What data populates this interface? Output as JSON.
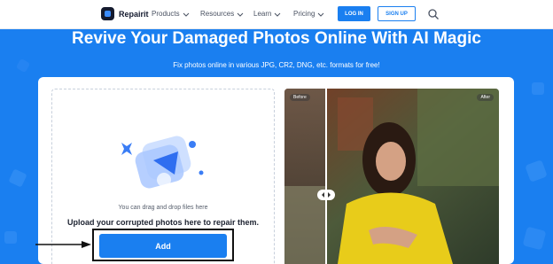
{
  "nav": {
    "logo_text": "Repairit",
    "items": [
      {
        "label": "Products"
      },
      {
        "label": "Resources"
      },
      {
        "label": "Learn"
      },
      {
        "label": "Pricing"
      }
    ],
    "login_label": "LOG IN",
    "signup_label": "SIGN UP",
    "search_icon": "search-icon"
  },
  "hero": {
    "title": "Revive Your Damaged Photos Online With AI Magic",
    "subtitle": "Fix photos online in various JPG, CR2, DNG, etc. formats for free!"
  },
  "upload": {
    "drag_text": "You can drag and drop files here",
    "instruction": "Upload your corrupted photos here to repair them.",
    "add_label": "Add"
  },
  "preview": {
    "before_label": "Before",
    "after_label": "After"
  },
  "colors": {
    "brand_blue": "#1a7ff0",
    "dark": "#141a2e"
  }
}
